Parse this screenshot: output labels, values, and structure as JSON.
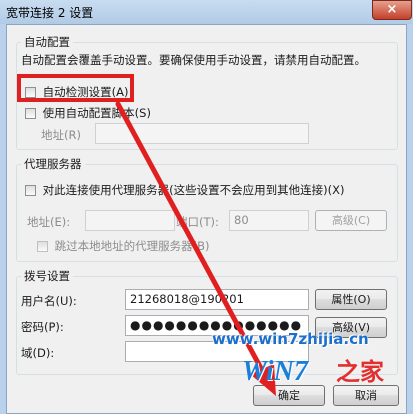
{
  "window": {
    "title": "宽带连接 2 设置",
    "close_symbol": "×"
  },
  "auto_config": {
    "legend": "自动配置",
    "description": "自动配置会覆盖手动设置。要确保使用手动设置，请禁用自动配置。",
    "auto_detect_label": "自动检测设置(A)",
    "use_script_label": "使用自动配置脚本(S)",
    "address_label": "地址(R)",
    "address_value": ""
  },
  "proxy": {
    "legend": "代理服务器",
    "use_proxy_label": "对此连接使用代理服务器(这些设置不会应用到其他连接)(X)",
    "address_label": "地址(E):",
    "address_value": "",
    "port_label": "端口(T):",
    "port_value": "80",
    "advanced_label": "高级(C)",
    "bypass_label": "跳过本地地址的代理服务器(B)"
  },
  "dialup": {
    "legend": "拨号设置",
    "username_label": "用户名(U):",
    "username_value": "21268018@190201",
    "properties_label": "属性(O)",
    "password_label": "密码(P):",
    "password_value": "●●●●●●●●●●●●●●●",
    "advanced_label": "高级(V)",
    "domain_label": "域(D):",
    "domain_value": ""
  },
  "footer": {
    "ok_label": "确定",
    "cancel_label": "取消"
  },
  "watermark": {
    "url": "www.win7zhijia.cn",
    "brand": "WiN7",
    "suffix": "之家"
  },
  "colors": {
    "highlight": "#e02020",
    "arrow": "#e02020",
    "brand_blue": "#1a7fd8"
  }
}
